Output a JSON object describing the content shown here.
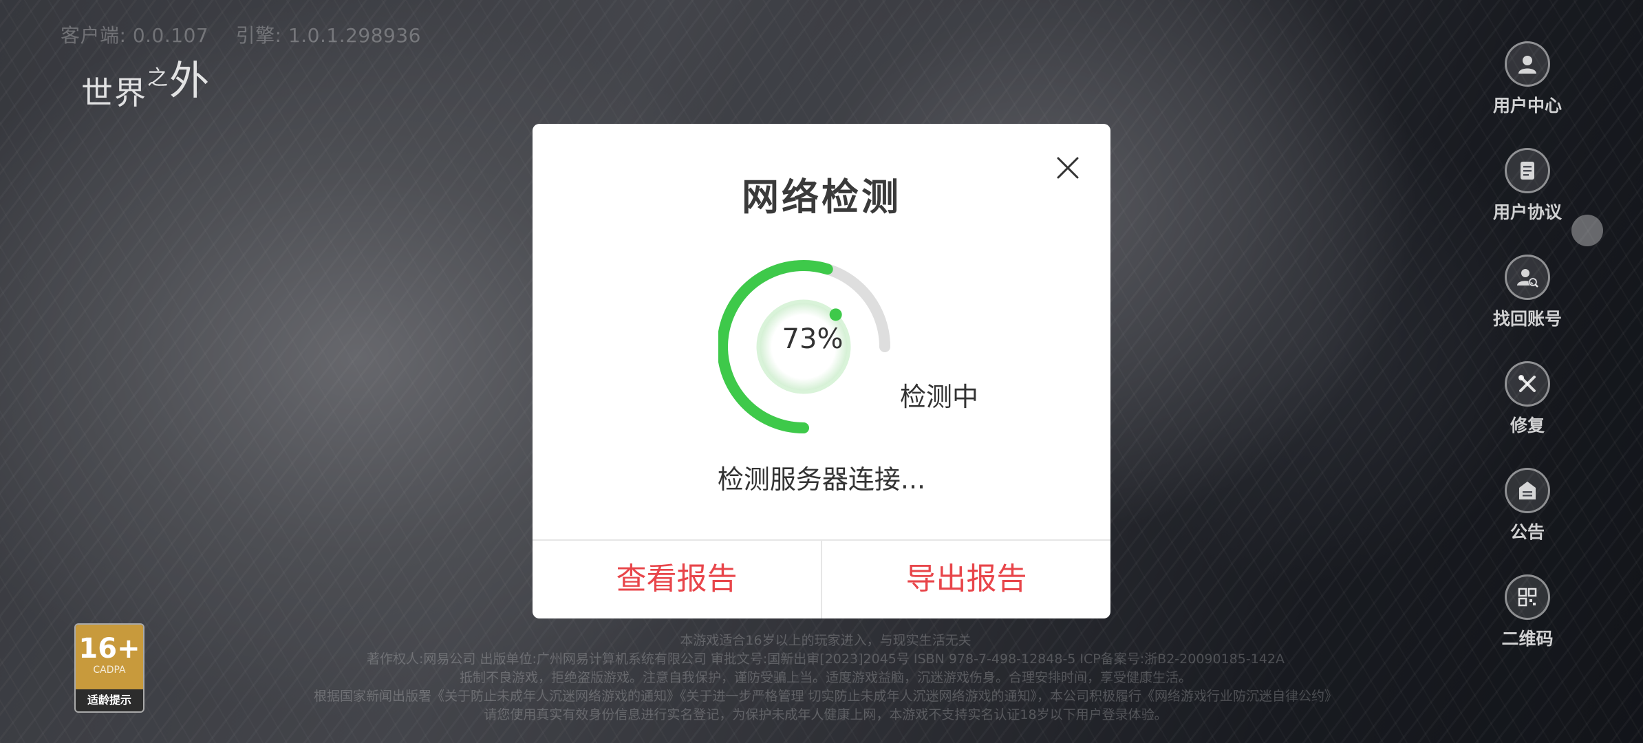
{
  "header": {
    "client_version": "客户端: 0.0.107",
    "engine_version": "引擎: 1.0.1.298936"
  },
  "logo": {
    "part1": "世界",
    "part2": "之",
    "part3": "外"
  },
  "side_menu": {
    "items": [
      {
        "label": "用户中心",
        "icon": "user-icon"
      },
      {
        "label": "用户协议",
        "icon": "document-icon"
      },
      {
        "label": "找回账号",
        "icon": "user-search-icon"
      },
      {
        "label": "修复",
        "icon": "tools-icon"
      },
      {
        "label": "公告",
        "icon": "announcement-icon"
      },
      {
        "label": "二维码",
        "icon": "qr-code-icon"
      }
    ]
  },
  "age_badge": {
    "rating": "16+",
    "org": "CADPA",
    "label": "适龄提示"
  },
  "footer": {
    "lines": [
      "本游戏适合16岁以上的玩家进入，与现实生活无关",
      "著作权人:网易公司 出版单位:广州网易计算机系统有限公司 审批文号:国新出审[2023]2045号 ISBN 978-7-498-12848-5 ICP备案号:浙B2-20090185-142A",
      "抵制不良游戏，拒绝盗版游戏。注意自我保护，谨防受骗上当。适度游戏益脑，沉迷游戏伤身。合理安排时间，享受健康生活。",
      "根据国家新闻出版署《关于防止未成年人沉迷网络游戏的通知》《关于进一步严格管理 切实防止未成年人沉迷网络游戏的通知》，本公司积极履行《网络游戏行业防沉迷自律公约》",
      "请您使用真实有效身份信息进行实名登记，为保护未成年人健康上网，本游戏不支持实名认证18岁以下用户登录体验。"
    ]
  },
  "dialog": {
    "title": "网络检测",
    "progress_percent": 73,
    "progress_text": "73%",
    "status": "检测中",
    "detail": "检测服务器连接...",
    "buttons": {
      "view_report": "查看报告",
      "export_report": "导出报告"
    }
  },
  "colors": {
    "accent_green": "#3ec94a",
    "track_gray": "#dedede",
    "button_red": "#e8454a",
    "title_text": "#3a3a3a"
  }
}
